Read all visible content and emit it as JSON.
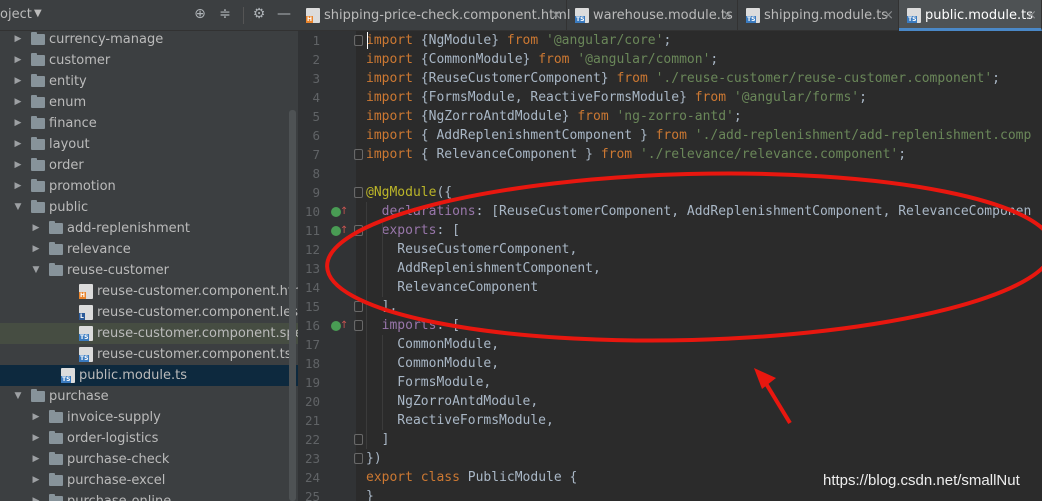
{
  "project_panel": {
    "title": "oject",
    "tree": [
      {
        "label": "currency-manage",
        "type": "folder",
        "expanded": false,
        "depth": 0
      },
      {
        "label": "customer",
        "type": "folder",
        "expanded": false,
        "depth": 0
      },
      {
        "label": "entity",
        "type": "folder",
        "expanded": false,
        "depth": 0
      },
      {
        "label": "enum",
        "type": "folder",
        "expanded": false,
        "depth": 0
      },
      {
        "label": "finance",
        "type": "folder",
        "expanded": false,
        "depth": 0
      },
      {
        "label": "layout",
        "type": "folder",
        "expanded": false,
        "depth": 0
      },
      {
        "label": "order",
        "type": "folder",
        "expanded": false,
        "depth": 0
      },
      {
        "label": "promotion",
        "type": "folder",
        "expanded": false,
        "depth": 0
      },
      {
        "label": "public",
        "type": "folder",
        "expanded": true,
        "depth": 0
      },
      {
        "label": "add-replenishment",
        "type": "folder",
        "expanded": false,
        "depth": 1
      },
      {
        "label": "relevance",
        "type": "folder",
        "expanded": false,
        "depth": 1
      },
      {
        "label": "reuse-customer",
        "type": "folder",
        "expanded": true,
        "depth": 1
      },
      {
        "label": "reuse-customer.component.html",
        "type": "html",
        "depth": 2
      },
      {
        "label": "reuse-customer.component.less",
        "type": "less",
        "depth": 2
      },
      {
        "label": "reuse-customer.component.spec.ts",
        "type": "spec",
        "depth": 2,
        "state": "highlighted"
      },
      {
        "label": "reuse-customer.component.ts",
        "type": "ts",
        "depth": 2
      },
      {
        "label": "public.module.ts",
        "type": "ts",
        "depth": 1,
        "state": "active"
      },
      {
        "label": "purchase",
        "type": "folder",
        "expanded": true,
        "depth": 0
      },
      {
        "label": "invoice-supply",
        "type": "folder",
        "expanded": false,
        "depth": 1
      },
      {
        "label": "order-logistics",
        "type": "folder",
        "expanded": false,
        "depth": 1
      },
      {
        "label": "purchase-check",
        "type": "folder",
        "expanded": false,
        "depth": 1
      },
      {
        "label": "purchase-excel",
        "type": "folder",
        "expanded": false,
        "depth": 1
      },
      {
        "label": "purchase-online",
        "type": "folder",
        "expanded": false,
        "depth": 1
      }
    ]
  },
  "tabs": [
    {
      "label": "shipping-price-check.component.html",
      "type": "html",
      "active": false
    },
    {
      "label": "warehouse.module.ts",
      "type": "ts",
      "active": false
    },
    {
      "label": "shipping.module.ts",
      "type": "ts",
      "active": false
    },
    {
      "label": "public.module.ts",
      "type": "ts",
      "active": true
    }
  ],
  "code_lines": [
    [
      [
        "kw",
        "import"
      ],
      [
        "t",
        " {NgModule} "
      ],
      [
        "kw",
        "from"
      ],
      [
        "t",
        " "
      ],
      [
        "str",
        "'@angular/core'"
      ],
      [
        "t",
        ";"
      ]
    ],
    [
      [
        "kw",
        "import"
      ],
      [
        "t",
        " {CommonModule} "
      ],
      [
        "kw",
        "from"
      ],
      [
        "t",
        " "
      ],
      [
        "str",
        "'@angular/common'"
      ],
      [
        "t",
        ";"
      ]
    ],
    [
      [
        "kw",
        "import"
      ],
      [
        "t",
        " {ReuseCustomerComponent} "
      ],
      [
        "kw",
        "from"
      ],
      [
        "t",
        " "
      ],
      [
        "str",
        "'./reuse-customer/reuse-customer.component'"
      ],
      [
        "t",
        ";"
      ]
    ],
    [
      [
        "kw",
        "import"
      ],
      [
        "t",
        " {FormsModule, ReactiveFormsModule} "
      ],
      [
        "kw",
        "from"
      ],
      [
        "t",
        " "
      ],
      [
        "str",
        "'@angular/forms'"
      ],
      [
        "t",
        ";"
      ]
    ],
    [
      [
        "kw",
        "import"
      ],
      [
        "t",
        " {NgZorroAntdModule} "
      ],
      [
        "kw",
        "from"
      ],
      [
        "t",
        " "
      ],
      [
        "str",
        "'ng-zorro-antd'"
      ],
      [
        "t",
        ";"
      ]
    ],
    [
      [
        "kw",
        "import"
      ],
      [
        "t",
        " { AddReplenishmentComponent } "
      ],
      [
        "kw",
        "from"
      ],
      [
        "t",
        " "
      ],
      [
        "str",
        "'./add-replenishment/add-replenishment.comp"
      ]
    ],
    [
      [
        "kw",
        "import"
      ],
      [
        "t",
        " { RelevanceComponent } "
      ],
      [
        "kw",
        "from"
      ],
      [
        "t",
        " "
      ],
      [
        "str",
        "'./relevance/relevance.component'"
      ],
      [
        "t",
        ";"
      ]
    ],
    [],
    [
      [
        "ann",
        "@NgModule"
      ],
      [
        "t",
        "({"
      ]
    ],
    [
      [
        "t",
        "  "
      ],
      [
        "prop",
        "declarations"
      ],
      [
        "t",
        ": [ReuseCustomerComponent, AddReplenishmentComponent, RelevanceComponen"
      ]
    ],
    [
      [
        "t",
        "  "
      ],
      [
        "prop",
        "exports"
      ],
      [
        "t",
        ": ["
      ]
    ],
    [
      [
        "t",
        "    ReuseCustomerComponent,"
      ]
    ],
    [
      [
        "t",
        "    AddReplenishmentComponent,"
      ]
    ],
    [
      [
        "t",
        "    RelevanceComponent"
      ]
    ],
    [
      [
        "t",
        "  ],"
      ]
    ],
    [
      [
        "t",
        "  "
      ],
      [
        "prop",
        "imports"
      ],
      [
        "t",
        ": ["
      ]
    ],
    [
      [
        "t",
        "    CommonModule,"
      ]
    ],
    [
      [
        "t",
        "    CommonModule,"
      ]
    ],
    [
      [
        "t",
        "    FormsModule,"
      ]
    ],
    [
      [
        "t",
        "    NgZorroAntdModule,"
      ]
    ],
    [
      [
        "t",
        "    ReactiveFormsModule,"
      ]
    ],
    [
      [
        "t",
        "  ]"
      ]
    ],
    [
      [
        "t",
        "})"
      ]
    ],
    [
      [
        "kw",
        "export"
      ],
      [
        "t",
        " "
      ],
      [
        "kw",
        "class"
      ],
      [
        "t",
        " PublicModule {"
      ]
    ],
    [
      [
        "t",
        "}"
      ]
    ]
  ],
  "gutter_markers": [
    10,
    11,
    16
  ],
  "watermark": "https://blog.csdn.net/smallNut",
  "annotation": {
    "color": "#e8170f"
  }
}
